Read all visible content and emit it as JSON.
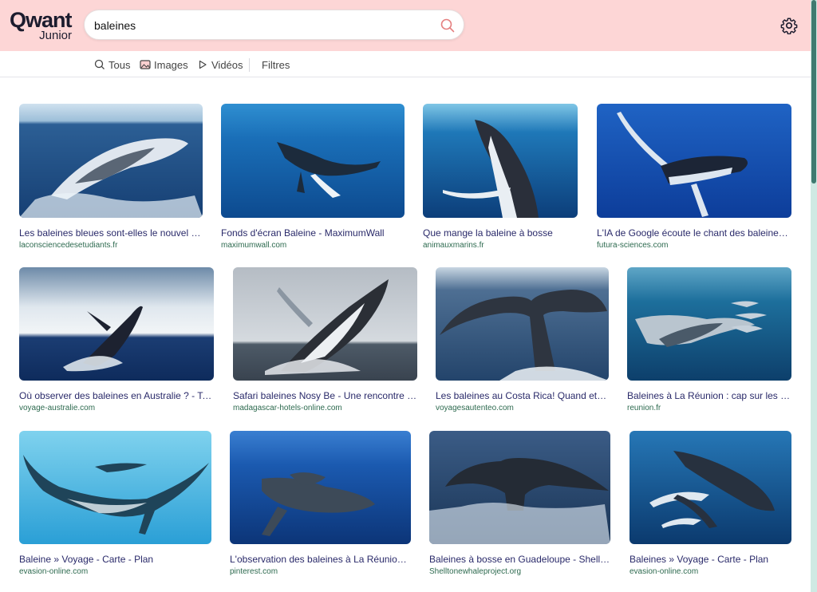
{
  "header": {
    "logo_main": "Qwant",
    "logo_sub": "Junior",
    "search_value": "baleines",
    "bg_color": "#fdd6d6",
    "accent_color": "#e55a5a"
  },
  "tabs": {
    "all": "Tous",
    "images": "Images",
    "videos": "Vidéos",
    "filters": "Filtres"
  },
  "results": [
    {
      "title": "Les baleines bleues sont-elles le nouvel esp…",
      "domain": "laconsciencedesetudiants.fr"
    },
    {
      "title": "Fonds d'écran Baleine - MaximumWall",
      "domain": "maximumwall.com"
    },
    {
      "title": "Que mange la baleine à bosse",
      "domain": "animauxmarins.fr"
    },
    {
      "title": "L'IA de Google écoute le chant des baleines p…",
      "domain": "futura-sciences.com"
    },
    {
      "title": "Où observer des baleines en Australie ? - Terr…",
      "domain": "voyage-australie.com"
    },
    {
      "title": "Safari baleines Nosy Be - Une rencontre res…",
      "domain": "madagascar-hotels-online.com"
    },
    {
      "title": "Les baleines au Costa Rica! Quand et où…",
      "domain": "voyagesautenteo.com"
    },
    {
      "title": "Baleines à La Réunion : cap sur les gé…",
      "domain": "reunion.fr"
    },
    {
      "title": "Baleine » Voyage - Carte - Plan",
      "domain": "evasion-online.com"
    },
    {
      "title": "L'observation des baleines à La Réunion | …",
      "domain": "pinterest.com"
    },
    {
      "title": "Baleines à bosse en Guadeloupe - Shellton…",
      "domain": "Shelltonewhaleproject.org"
    },
    {
      "title": "Baleines » Voyage - Carte - Plan",
      "domain": "evasion-online.com"
    }
  ]
}
